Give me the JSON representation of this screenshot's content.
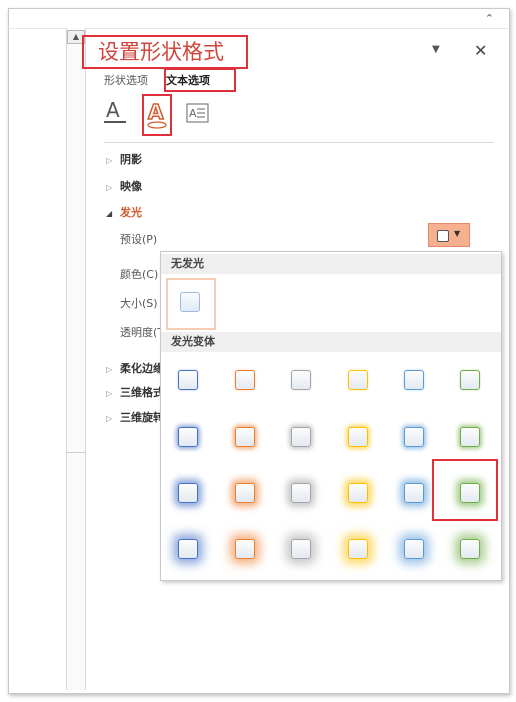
{
  "panel": {
    "title": "设置形状格式",
    "tabs": {
      "shape_options": "形状选项",
      "text_options": "文本选项"
    },
    "icons": [
      "text-fill-outline-icon",
      "text-effects-icon",
      "textbox-icon"
    ]
  },
  "sections": [
    {
      "label": "阴影",
      "expanded": false
    },
    {
      "label": "映像",
      "expanded": false
    },
    {
      "label": "发光",
      "expanded": true
    },
    {
      "label": "柔化边缘",
      "expanded": false
    },
    {
      "label": "三维格式",
      "expanded": false
    },
    {
      "label": "三维旋转",
      "expanded": false
    }
  ],
  "glow": {
    "preset_label": "预设(P)",
    "color_label": "颜色(C)",
    "size_label": "大小(S)",
    "transparency_label": "透明度(T)"
  },
  "gallery": {
    "no_glow_header": "无发光",
    "variants_header": "发光变体",
    "columns": [
      "#4472c4",
      "#ed7d31",
      "#a5a5a5",
      "#ffc000",
      "#5b9bd5",
      "#70ad47"
    ],
    "rows": 4,
    "selected": {
      "row": 3,
      "col": 6
    }
  },
  "colors": {
    "accent": "#d25a2c",
    "highlight": "#e0303a"
  }
}
